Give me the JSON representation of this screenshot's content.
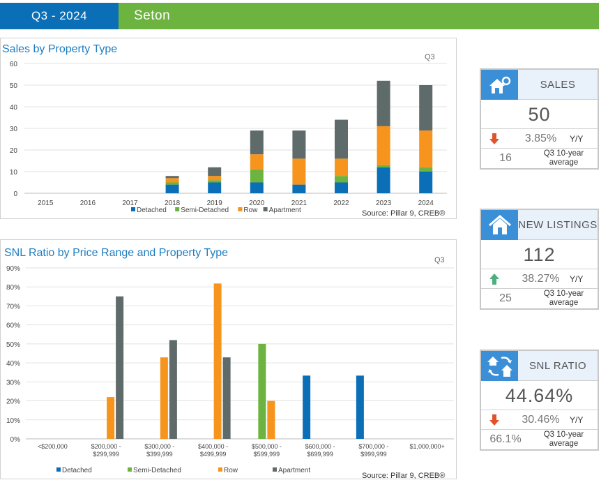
{
  "header": {
    "period": "Q3 - 2024",
    "community": "Seton"
  },
  "colors": {
    "detached": "#0a6fb7",
    "semi": "#6cb33f",
    "row": "#f7941d",
    "apartment": "#5f6b6a",
    "down": "#e0532a",
    "up": "#4caf7d"
  },
  "chart_data": [
    {
      "type": "bar",
      "stacked": true,
      "title": "Sales by Property Type",
      "corner_label": "Q3",
      "source": "Source: Pillar 9, CREB®",
      "categories": [
        "2015",
        "2016",
        "2017",
        "2018",
        "2019",
        "2020",
        "2021",
        "2022",
        "2023",
        "2024"
      ],
      "yticks": [
        "0",
        "10",
        "20",
        "30",
        "40",
        "50",
        "60"
      ],
      "ylim": [
        0,
        60
      ],
      "legend_position": "bottom",
      "series": [
        {
          "name": "Detached",
          "color": "#0a6fb7",
          "values": [
            0,
            0,
            0,
            4,
            5,
            5,
            4,
            5,
            12,
            10
          ]
        },
        {
          "name": "Semi-Detached",
          "color": "#6cb33f",
          "values": [
            0,
            0,
            0,
            1,
            1,
            6,
            0,
            3,
            1,
            2
          ]
        },
        {
          "name": "Row",
          "color": "#f7941d",
          "values": [
            0,
            0,
            0,
            2,
            2,
            7,
            12,
            8,
            18,
            17
          ]
        },
        {
          "name": "Apartment",
          "color": "#5f6b6a",
          "values": [
            0,
            0,
            0,
            1,
            4,
            11,
            13,
            18,
            21,
            21
          ]
        }
      ]
    },
    {
      "type": "bar",
      "stacked": false,
      "title": "SNL Ratio by Price Range and Property Type",
      "corner_label": "Q3",
      "source": "Source: Pillar 9, CREB®",
      "categories": [
        [
          "<$200,000",
          ""
        ],
        [
          "$200,000 -",
          "$299,999"
        ],
        [
          "$300,000 -",
          "$399,999"
        ],
        [
          "$400,000 -",
          "$499,999"
        ],
        [
          "$500,000 -",
          "$599,999"
        ],
        [
          "$600,000 -",
          "$699,999"
        ],
        [
          "$700,000 -",
          "$999,999"
        ],
        [
          "$1,000,000+",
          ""
        ]
      ],
      "yticks": [
        "0%",
        "10%",
        "20%",
        "30%",
        "40%",
        "50%",
        "60%",
        "70%",
        "80%",
        "90%"
      ],
      "ylim": [
        0,
        90
      ],
      "legend_position": "bottom",
      "series": [
        {
          "name": "Detached",
          "color": "#0a6fb7",
          "values": [
            null,
            null,
            null,
            null,
            null,
            33.3,
            33.3,
            null
          ]
        },
        {
          "name": "Semi-Detached",
          "color": "#6cb33f",
          "values": [
            null,
            null,
            null,
            null,
            50,
            null,
            null,
            null
          ]
        },
        {
          "name": "Row",
          "color": "#f7941d",
          "values": [
            null,
            22,
            42.9,
            81.8,
            20,
            null,
            null,
            null
          ]
        },
        {
          "name": "Apartment",
          "color": "#5f6b6a",
          "values": [
            null,
            75,
            52,
            42.9,
            null,
            null,
            null,
            null
          ]
        }
      ]
    }
  ],
  "kpis": [
    {
      "label": "SALES",
      "icon": "house-key-icon",
      "value": "50",
      "trend": "down",
      "yoy": "3.85%",
      "yoy_label": "Y/Y",
      "avg_value": "16",
      "avg_label_1": "Q3 10-year",
      "avg_label_2": "average"
    },
    {
      "label": "NEW LISTINGS",
      "icon": "house-icon",
      "value": "112",
      "trend": "up",
      "yoy": "38.27%",
      "yoy_label": "Y/Y",
      "avg_value": "25",
      "avg_label_1": "Q3 10-year",
      "avg_label_2": "average"
    },
    {
      "label": "SNL RATIO",
      "icon": "houses-exchange-icon",
      "value": "44.64%",
      "trend": "down",
      "yoy": "30.46%",
      "yoy_label": "Y/Y",
      "avg_value": "66.1%",
      "avg_label_1": "Q3 10-year",
      "avg_label_2": "average"
    }
  ]
}
